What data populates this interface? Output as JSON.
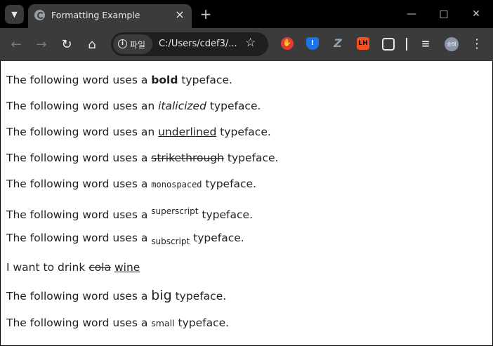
{
  "browser": {
    "tab": {
      "title": "Formatting Example",
      "close_icon": "×"
    },
    "new_tab_icon": "+",
    "address": {
      "site_label": "파일",
      "url": "C:/Users/cdef3/..."
    },
    "profile_initials": "승태",
    "extensions": [
      {
        "name": "hand-stop-icon",
        "color": "#e53935"
      },
      {
        "name": "shield-icon",
        "color": "#1a73e8"
      },
      {
        "name": "z-icon",
        "color": "#6a7b8c"
      },
      {
        "name": "lighthouse-icon",
        "text": "LH",
        "color": "#f4511e"
      },
      {
        "name": "puzzle-icon",
        "color": "#e8e8e8"
      }
    ]
  },
  "content": {
    "bold": {
      "pre": "The following word uses a ",
      "word": "bold",
      "post": " typeface."
    },
    "italic": {
      "pre": "The following word uses an ",
      "word": "italicized",
      "post": " typeface."
    },
    "underline": {
      "pre": "The following word uses an ",
      "word": "underlined",
      "post": " typeface."
    },
    "strike": {
      "pre": "The following word uses a ",
      "word": "strikethrough",
      "post": " typeface."
    },
    "mono": {
      "pre": "The following word uses a ",
      "word": "monospaced",
      "post": " typeface."
    },
    "sup": {
      "pre": "The following word uses a ",
      "word": "superscript",
      "post": " typeface."
    },
    "sub": {
      "pre": "The following word uses a ",
      "word": "subscript",
      "post": " typeface."
    },
    "drink": {
      "pre": "I want to drink ",
      "deleted": "cola",
      "inserted": "wine"
    },
    "big": {
      "pre": "The following word uses a ",
      "word": "big",
      "post": " typeface."
    },
    "small": {
      "pre": "The following word uses a ",
      "word": "small",
      "post": " typeface."
    }
  }
}
